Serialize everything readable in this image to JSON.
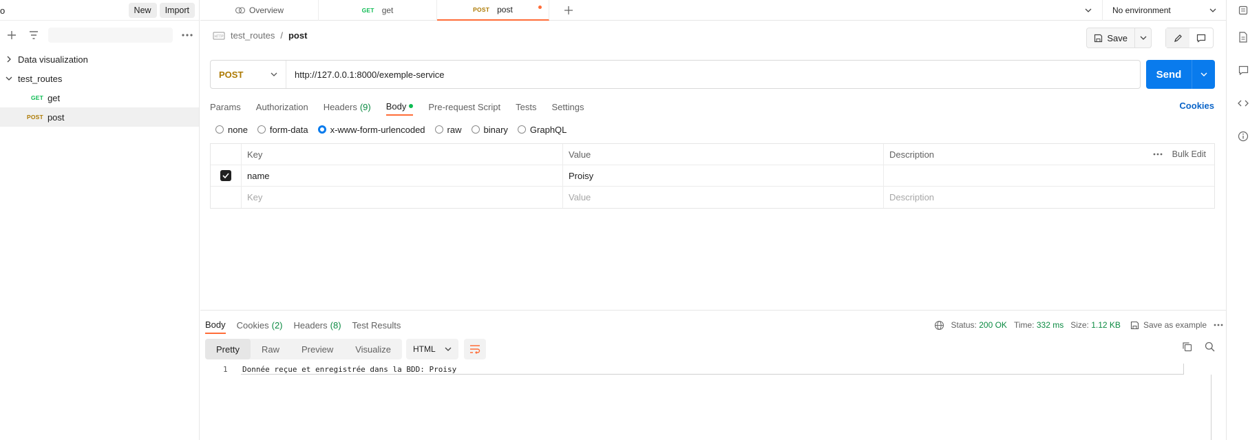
{
  "sidebar": {
    "stub_char": "o",
    "new_label": "New",
    "import_label": "Import",
    "items": [
      {
        "label": "Data visualization"
      },
      {
        "label": "test_routes"
      },
      {
        "method": "GET",
        "label": "get"
      },
      {
        "method": "POST",
        "label": "post"
      }
    ]
  },
  "tabs": [
    {
      "label": "Overview"
    },
    {
      "method": "GET",
      "label": "get"
    },
    {
      "method": "POST",
      "label": "post"
    }
  ],
  "environment": {
    "label": "No environment"
  },
  "request": {
    "breadcrumb": {
      "collection": "test_routes",
      "separator": "/",
      "current": "post"
    },
    "save_label": "Save",
    "method": "POST",
    "url": "http://127.0.0.1:8000/exemple-service",
    "send_label": "Send",
    "tabs": [
      {
        "label": "Params"
      },
      {
        "label": "Authorization"
      },
      {
        "label": "Headers",
        "count": "(9)"
      },
      {
        "label": "Body"
      },
      {
        "label": "Pre-request Script"
      },
      {
        "label": "Tests"
      },
      {
        "label": "Settings"
      }
    ],
    "cookies_label": "Cookies",
    "body_modes": [
      "none",
      "form-data",
      "x-www-form-urlencoded",
      "raw",
      "binary",
      "GraphQL"
    ],
    "table": {
      "headers": {
        "key": "Key",
        "value": "Value",
        "description": "Description",
        "bulk_edit": "Bulk Edit"
      },
      "rows": [
        {
          "key": "name",
          "value": "Proisy",
          "description": ""
        }
      ],
      "placeholders": {
        "key": "Key",
        "value": "Value",
        "description": "Description"
      }
    }
  },
  "response": {
    "tabs": [
      {
        "label": "Body"
      },
      {
        "label": "Cookies",
        "count": "(2)"
      },
      {
        "label": "Headers",
        "count": "(8)"
      },
      {
        "label": "Test Results"
      }
    ],
    "status_label": "Status:",
    "status_value": "200 OK",
    "time_label": "Time:",
    "time_value": "332 ms",
    "size_label": "Size:",
    "size_value": "1.12 KB",
    "save_example": "Save as example",
    "formats": [
      "Pretty",
      "Raw",
      "Preview",
      "Visualize"
    ],
    "language": "HTML",
    "line_number": "1",
    "body_text": "Donnée reçue et enregistrée dans la BDD: Proisy"
  },
  "colors": {
    "accent": "#ff6c37",
    "send": "#097bed",
    "post": "#ad7a03",
    "get": "#0cbb52",
    "ok": "#0a8a41"
  }
}
